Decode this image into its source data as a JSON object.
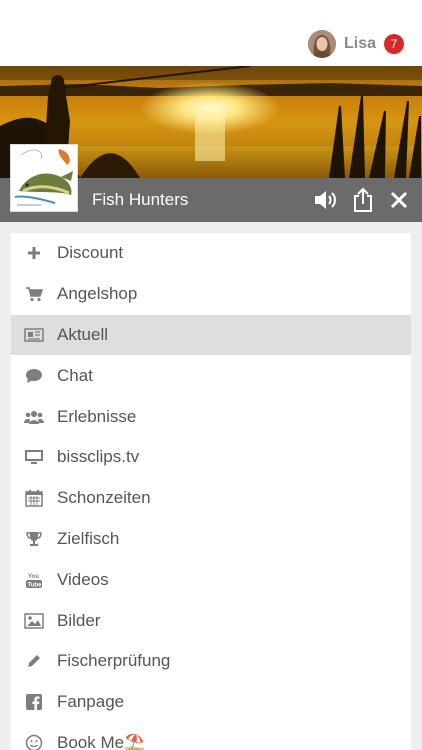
{
  "user": {
    "name": "Lisa",
    "notifications": "7"
  },
  "page": {
    "title": "Fish Hunters"
  },
  "colors": {
    "badge": "#d62a2a",
    "titlebar": "#6b6b6b",
    "active_item": "#dedede"
  },
  "menu": {
    "items": [
      {
        "label": "Discount",
        "icon": "plus-icon",
        "active": false
      },
      {
        "label": "Angelshop",
        "icon": "cart-icon",
        "active": false
      },
      {
        "label": "Aktuell",
        "icon": "newspaper-icon",
        "active": true
      },
      {
        "label": "Chat",
        "icon": "chat-bubble-icon",
        "active": false
      },
      {
        "label": "Erlebnisse",
        "icon": "users-icon",
        "active": false
      },
      {
        "label": "bissclips.tv",
        "icon": "monitor-icon",
        "active": false
      },
      {
        "label": "Schonzeiten",
        "icon": "calendar-icon",
        "active": false
      },
      {
        "label": "Zielfisch",
        "icon": "trophy-icon",
        "active": false
      },
      {
        "label": "Videos",
        "icon": "youtube-icon",
        "active": false
      },
      {
        "label": "Bilder",
        "icon": "image-icon",
        "active": false
      },
      {
        "label": "Fischerprüfung",
        "icon": "pencil-icon",
        "active": false
      },
      {
        "label": "Fanpage",
        "icon": "facebook-icon",
        "active": false
      },
      {
        "label": "Book Me⛱️",
        "icon": "smiley-icon",
        "active": false
      }
    ]
  }
}
